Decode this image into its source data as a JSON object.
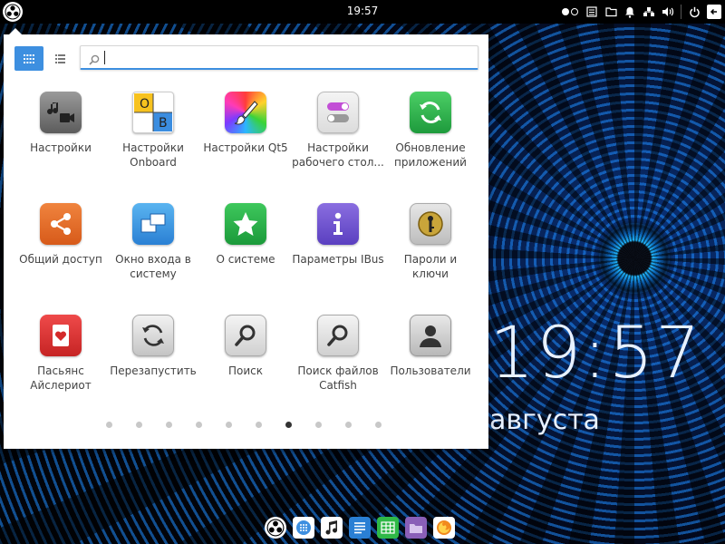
{
  "panel": {
    "time": "19:57",
    "icons": [
      "start-menu-icon",
      "keyboard-layout-icon",
      "notes-icon",
      "folder-icon",
      "notification-bell-icon",
      "network-icon",
      "volume-icon",
      "power-icon",
      "show-desktop-icon"
    ]
  },
  "desktop": {
    "big_time": "19:57",
    "date_fragment": "августа"
  },
  "menu": {
    "search": {
      "value": "",
      "placeholder": ""
    },
    "view_modes": [
      "grid",
      "list"
    ],
    "apps": [
      {
        "label": "Настройки",
        "icon": "settings-media-icon"
      },
      {
        "label": "Настройки Onboard",
        "icon": "onboard-keyboard-icon"
      },
      {
        "label": "Настройки Qt5",
        "icon": "qt5-brush-icon"
      },
      {
        "label": "Настройки рабочего стол...",
        "icon": "desktop-toggles-icon"
      },
      {
        "label": "Обновление приложений",
        "icon": "update-arrows-icon"
      },
      {
        "label": "Общий доступ",
        "icon": "share-icon"
      },
      {
        "label": "Окно входа в систему",
        "icon": "login-window-icon"
      },
      {
        "label": "О системе",
        "icon": "star-icon"
      },
      {
        "label": "Параметры IBus",
        "icon": "info-icon"
      },
      {
        "label": "Пароли и ключи",
        "icon": "keyring-icon"
      },
      {
        "label": "Пасьянс Айслериот",
        "icon": "card-heart-icon"
      },
      {
        "label": "Перезапустить",
        "icon": "restart-icon"
      },
      {
        "label": "Поиск",
        "icon": "magnifier-icon"
      },
      {
        "label": "Поиск файлов Catfish",
        "icon": "catfish-search-icon"
      },
      {
        "label": "Пользователи",
        "icon": "user-avatar-icon"
      }
    ],
    "pages": {
      "count": 10,
      "current": 7
    }
  },
  "dock": {
    "items": [
      "start-menu-icon",
      "browser-icon",
      "music-icon",
      "text-editor-icon",
      "spreadsheet-icon",
      "file-manager-icon",
      "firefox-icon"
    ]
  },
  "colors": {
    "accent": "#3d8fe0",
    "panel": "#000000",
    "menu_bg": "#ffffff"
  }
}
